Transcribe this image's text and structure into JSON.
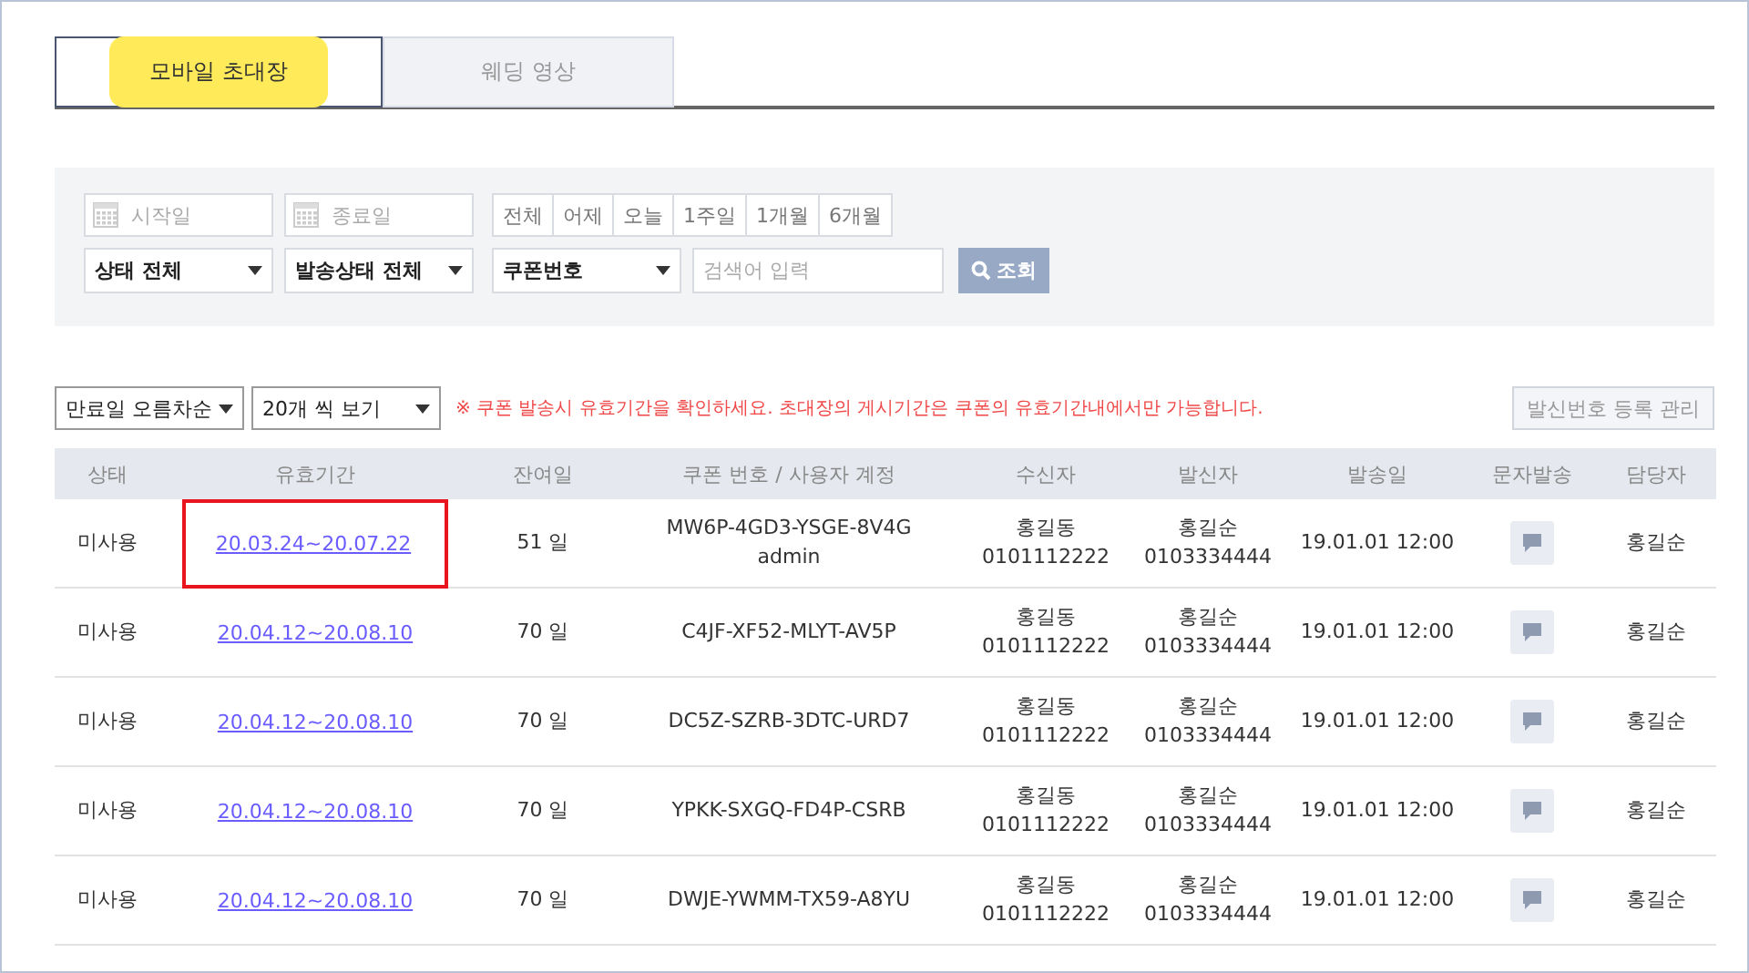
{
  "tabs": [
    {
      "label": "모바일 초대장",
      "selected": true
    },
    {
      "label": "웨딩 영상",
      "selected": false
    }
  ],
  "filters": {
    "start_date": {
      "placeholder": "시작일"
    },
    "end_date": {
      "placeholder": "종료일"
    },
    "periods": [
      "전체",
      "어제",
      "오늘",
      "1주일",
      "1개월",
      "6개월"
    ],
    "status_select": "상태 전체",
    "send_status_select": "발송상태 전체",
    "search_type_select": "쿠폰번호",
    "search": {
      "placeholder": "검색어 입력"
    },
    "search_button": "조회"
  },
  "toolbar": {
    "sort_select": "만료일 오름차순",
    "page_size_select": "20개 씩 보기",
    "notice": "※ 쿠폰 발송시 유효기간을 확인하세요. 초대장의 게시기간은 쿠폰의 유효기간내에서만 가능합니다.",
    "manage_button": "발신번호 등록 관리"
  },
  "table": {
    "columns": [
      "상태",
      "유효기간",
      "잔여일",
      "쿠폰 번호 / 사용자 계정",
      "수신자",
      "발신자",
      "발송일",
      "문자발송",
      "담당자"
    ],
    "rows": [
      {
        "status": "미사용",
        "period": "20.03.24~20.07.22",
        "highlighted": true,
        "remaining": "51 일",
        "coupon": "MW6P-4GD3-YSGE-8V4G",
        "account": "admin",
        "receiver": "홍길동",
        "receiver_phone": "0101112222",
        "sender": "홍길순",
        "sender_phone": "0103334444",
        "sent": "19.01.01 12:00",
        "manager": "홍길순"
      },
      {
        "status": "미사용",
        "period": "20.04.12~20.08.10",
        "highlighted": false,
        "remaining": "70 일",
        "coupon": "C4JF-XF52-MLYT-AV5P",
        "receiver": "홍길동",
        "receiver_phone": "0101112222",
        "sender": "홍길순",
        "sender_phone": "0103334444",
        "sent": "19.01.01 12:00",
        "manager": "홍길순"
      },
      {
        "status": "미사용",
        "period": "20.04.12~20.08.10",
        "highlighted": false,
        "remaining": "70 일",
        "coupon": "DC5Z-SZRB-3DTC-URD7",
        "receiver": "홍길동",
        "receiver_phone": "0101112222",
        "sender": "홍길순",
        "sender_phone": "0103334444",
        "sent": "19.01.01 12:00",
        "manager": "홍길순"
      },
      {
        "status": "미사용",
        "period": "20.04.12~20.08.10",
        "highlighted": false,
        "remaining": "70 일",
        "coupon": "YPKK-SXGQ-FD4P-CSRB",
        "receiver": "홍길동",
        "receiver_phone": "0101112222",
        "sender": "홍길순",
        "sender_phone": "0103334444",
        "sent": "19.01.01 12:00",
        "manager": "홍길순"
      },
      {
        "status": "미사용",
        "period": "20.04.12~20.08.10",
        "highlighted": false,
        "remaining": "70 일",
        "coupon": "DWJE-YWMM-TX59-A8YU",
        "receiver": "홍길동",
        "receiver_phone": "0101112222",
        "sender": "홍길순",
        "sender_phone": "0103334444",
        "sent": "19.01.01 12:00",
        "manager": "홍길순"
      }
    ]
  }
}
